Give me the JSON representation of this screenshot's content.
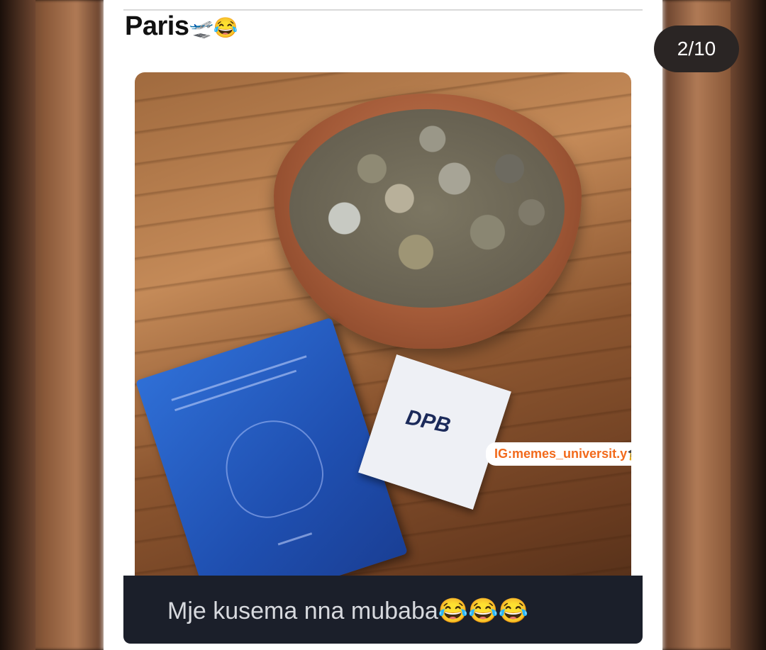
{
  "post": {
    "caption": "Paris",
    "caption_emoji": "🛫😂",
    "photo": {
      "description_icons": [
        "bowl-of-coins",
        "passport",
        "bank-card"
      ],
      "card_logo": "DPB",
      "watermark": "IG:memes_universit.y🎓"
    },
    "subtitle": "Mje kusema nna mubaba😂😂😂"
  },
  "gallery": {
    "counter": "2/10"
  },
  "colors": {
    "watermark_text": "#f26a1b",
    "passport_blue": "#1f4fb0",
    "counter_bg": "#2a2524"
  }
}
